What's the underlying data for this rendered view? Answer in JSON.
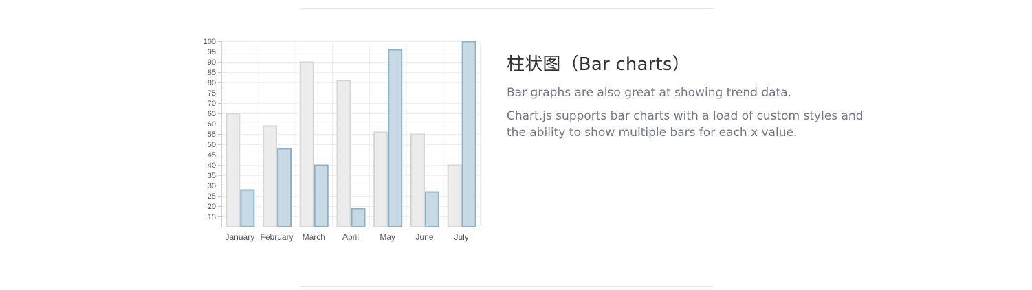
{
  "section": {
    "heading": "柱状图（Bar charts）",
    "paragraph1": "Bar graphs are also great at showing trend data.",
    "paragraph2": "Chart.js supports bar charts with a load of custom styles and the ability to show multiple bars for each x value."
  },
  "colors": {
    "series1_fill": "#ececec",
    "series1_stroke": "#d6d6d6",
    "series2_fill": "#c6d9e4",
    "series2_stroke": "#8db0c6",
    "grid": "#f0f0f0",
    "axis": "#d0d0d0"
  },
  "chart_data": {
    "type": "bar",
    "categories": [
      "January",
      "February",
      "March",
      "April",
      "May",
      "June",
      "July"
    ],
    "series": [
      {
        "values": [
          65,
          59,
          90,
          81,
          56,
          55,
          40
        ]
      },
      {
        "values": [
          28,
          48,
          40,
          19,
          96,
          27,
          100
        ]
      }
    ],
    "y_ticks": [
      15,
      20,
      25,
      30,
      35,
      40,
      45,
      50,
      55,
      60,
      65,
      70,
      75,
      80,
      85,
      90,
      95,
      100
    ],
    "ylim": [
      10,
      100
    ],
    "grid": true,
    "legend": "none",
    "title": "",
    "xlabel": "",
    "ylabel": ""
  }
}
